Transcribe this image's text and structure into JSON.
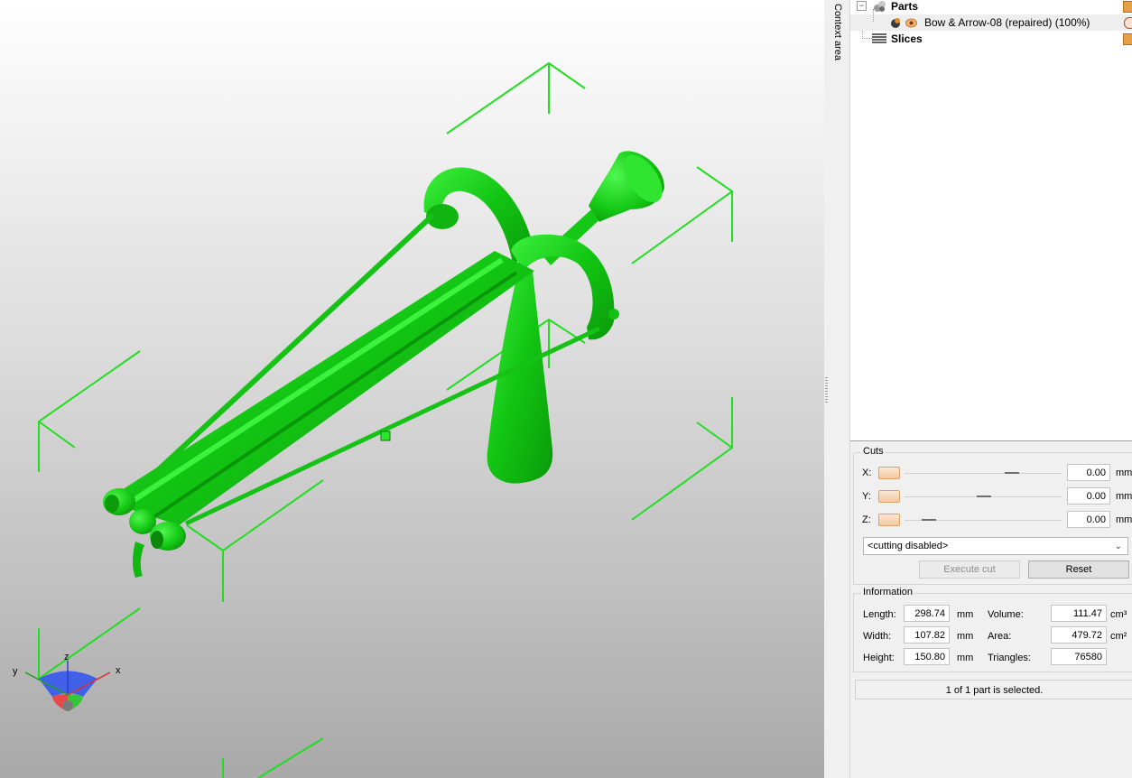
{
  "context_area_label": "Context area",
  "tree": {
    "parts_label": "Parts",
    "part_item_label": "Bow & Arrow-08 (repaired) (100%)",
    "slices_label": "Slices",
    "expander_symbol": "−"
  },
  "cuts": {
    "title": "Cuts",
    "axes": [
      {
        "label": "X:",
        "value": "0.00",
        "unit": "mm"
      },
      {
        "label": "Y:",
        "value": "0.00",
        "unit": "mm"
      },
      {
        "label": "Z:",
        "value": "0.00",
        "unit": "mm"
      }
    ],
    "mode_select": "<cutting disabled>",
    "execute_label": "Execute cut",
    "reset_label": "Reset"
  },
  "information": {
    "title": "Information",
    "length_label": "Length:",
    "length_value": "298.74",
    "length_unit": "mm",
    "width_label": "Width:",
    "width_value": "107.82",
    "width_unit": "mm",
    "height_label": "Height:",
    "height_value": "150.80",
    "height_unit": "mm",
    "volume_label": "Volume:",
    "volume_value": "111.47",
    "volume_unit": "cm³",
    "area_label": "Area:",
    "area_value": "479.72",
    "area_unit": "cm²",
    "triangles_label": "Triangles:",
    "triangles_value": "76580"
  },
  "status_text": "1 of 1 part is selected.",
  "axis_gizmo": {
    "x_label": "x",
    "y_label": "y",
    "z_label": "z"
  },
  "colors": {
    "model_green": "#17d417",
    "bbox_green": "#22dd22",
    "accent_orange": "#e8a060"
  }
}
